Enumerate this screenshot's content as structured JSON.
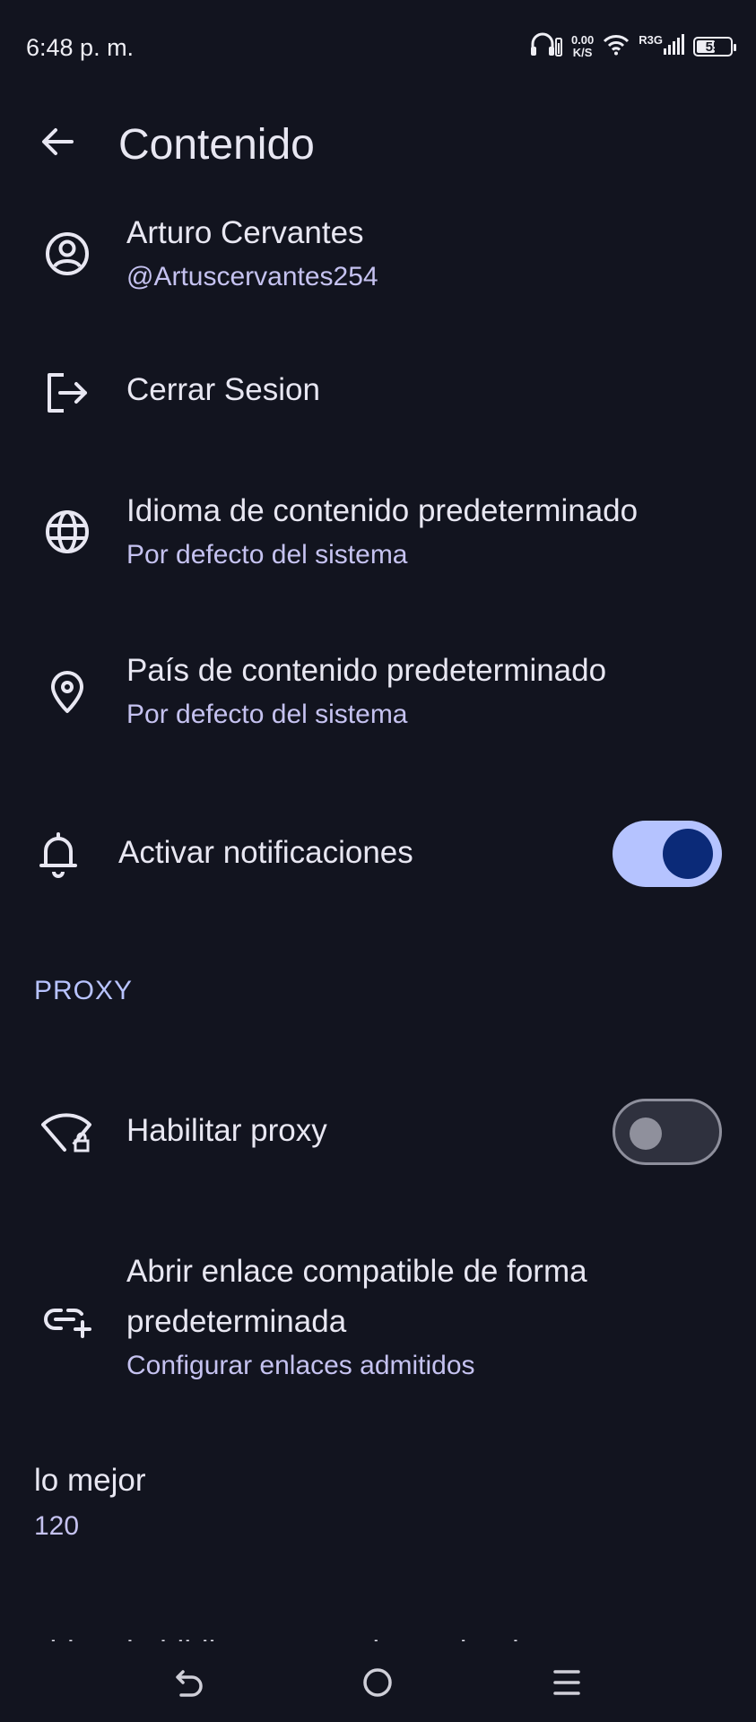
{
  "status_bar": {
    "time": "6:48 p. m.",
    "net_speed_value": "0.00",
    "net_speed_unit": "K/S",
    "signal_label": "R3G",
    "battery_level": "55",
    "battery_fraction": 0.55
  },
  "app_bar": {
    "title": "Contenido",
    "back_icon": "arrow-left-icon"
  },
  "account": {
    "name": "Arturo Cervantes",
    "handle": "@Artuscervantes254",
    "icon": "account-circle-icon"
  },
  "logout": {
    "label": "Cerrar Sesion",
    "icon": "logout-icon"
  },
  "content_language": {
    "title": "Idioma de contenido predeterminado",
    "value": "Por defecto del sistema",
    "icon": "globe-icon"
  },
  "content_country": {
    "title": "País de contenido predeterminado",
    "value": "Por defecto del sistema",
    "icon": "location-pin-icon"
  },
  "notifications": {
    "label": "Activar notificaciones",
    "enabled": true,
    "icon": "bell-icon"
  },
  "proxy_section": {
    "header": "PROXY"
  },
  "proxy": {
    "label": "Habilitar proxy",
    "enabled": false,
    "icon": "wifi-lock-icon"
  },
  "open_links": {
    "title_line1": "Abrir enlace compatible de forma",
    "title_line2": "predeterminada",
    "value": "Configurar enlaces admitidos",
    "icon": "link-add-icon"
  },
  "quality": {
    "title": "lo mejor",
    "value": "120"
  },
  "partial_row": {
    "title": "cbios de bibliotecas predeterminadas"
  },
  "colors": {
    "background": "#12141f",
    "accent": "#b8c3ff",
    "toggle_on_track": "#b5c3ff",
    "toggle_on_knob": "#0b2a78"
  },
  "nav_bar": {
    "back_icon": "nav-back-icon",
    "home_icon": "nav-home-icon",
    "menu_icon": "nav-menu-icon"
  }
}
